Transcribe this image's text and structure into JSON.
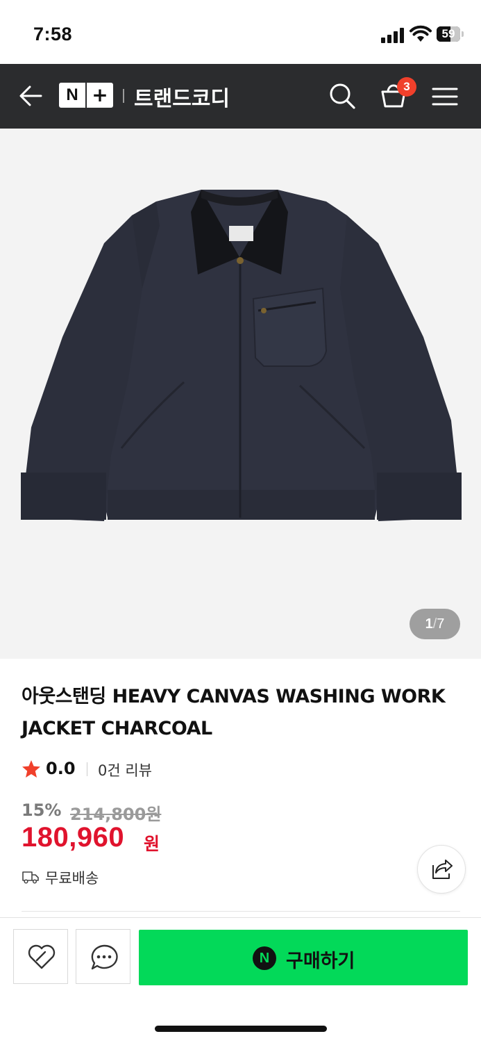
{
  "status_bar": {
    "time": "7:58",
    "battery": "59",
    "battery_level": 0.59
  },
  "nav": {
    "logo_n": "N",
    "logo_plus": "+",
    "store_name": "트랜드코디",
    "cart_count": "3",
    "icons": [
      "back-arrow-icon",
      "search-icon",
      "cart-icon",
      "menu-icon"
    ]
  },
  "gallery": {
    "current": "1",
    "separator": "/",
    "total": "7"
  },
  "product": {
    "title": "아웃스탠딩 HEAVY CANVAS WASHING WORK JACKET CHARCOAL",
    "rating": "0.0",
    "review_count": "0건 리뷰",
    "discount": "15%",
    "original_price": "214,800원",
    "price": "180,960",
    "currency": "원",
    "shipping": "무료배송"
  },
  "actions": {
    "buy_label": "구매하기",
    "buy_logo": "N",
    "icons": [
      "heart-icon",
      "chat-icon",
      "share-icon"
    ]
  },
  "colors": {
    "nav_bg": "#2b2c2e",
    "price_red": "#e0132d",
    "buy_green": "#03d959",
    "badge_red": "#f0402b"
  }
}
